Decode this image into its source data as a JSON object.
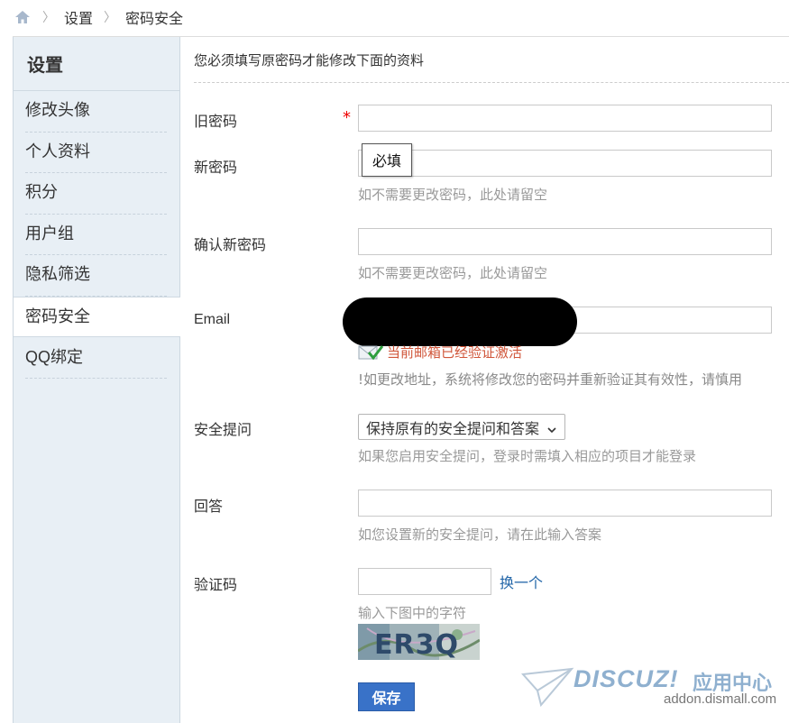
{
  "breadcrumb": {
    "items": [
      "设置",
      "密码安全"
    ]
  },
  "sidebar": {
    "title": "设置",
    "items": [
      {
        "label": "修改头像"
      },
      {
        "label": "个人资料"
      },
      {
        "label": "积分"
      },
      {
        "label": "用户组"
      },
      {
        "label": "隐私筛选"
      },
      {
        "label": "密码安全",
        "active": true
      },
      {
        "label": "QQ绑定"
      }
    ]
  },
  "main": {
    "notice": "您必须填写原密码才能修改下面的资料",
    "fields": {
      "old_password": {
        "label": "旧密码",
        "required_mark": "*",
        "value": ""
      },
      "new_password": {
        "label": "新密码",
        "value": "",
        "hint": "如不需要更改密码，此处请留空",
        "tooltip": "必填"
      },
      "confirm_password": {
        "label": "确认新密码",
        "value": "",
        "hint": "如不需要更改密码，此处请留空"
      },
      "email": {
        "label": "Email",
        "status": "当前邮箱已经验证激活",
        "hint": "!如更改地址，系统将修改您的密码并重新验证其有效性，请慎用"
      },
      "security_question": {
        "label": "安全提问",
        "selected": "保持原有的安全提问和答案",
        "hint": "如果您启用安全提问，登录时需填入相应的项目才能登录"
      },
      "answer": {
        "label": "回答",
        "value": "",
        "hint": "如您设置新的安全提问，请在此输入答案"
      },
      "captcha": {
        "label": "验证码",
        "value": "",
        "change_label": "换一个",
        "hint": "输入下图中的字符",
        "image_text": "ER3Q"
      }
    },
    "save_label": "保存"
  },
  "watermark": {
    "brand": "DISCUZ!",
    "cn": "应用中心",
    "url": "addon.dismall.com"
  },
  "colors": {
    "sidebar_bg": "#e8eff5",
    "accent": "#3972c8",
    "link": "#2366a8",
    "required": "#e00000",
    "verified": "#d0563a"
  }
}
